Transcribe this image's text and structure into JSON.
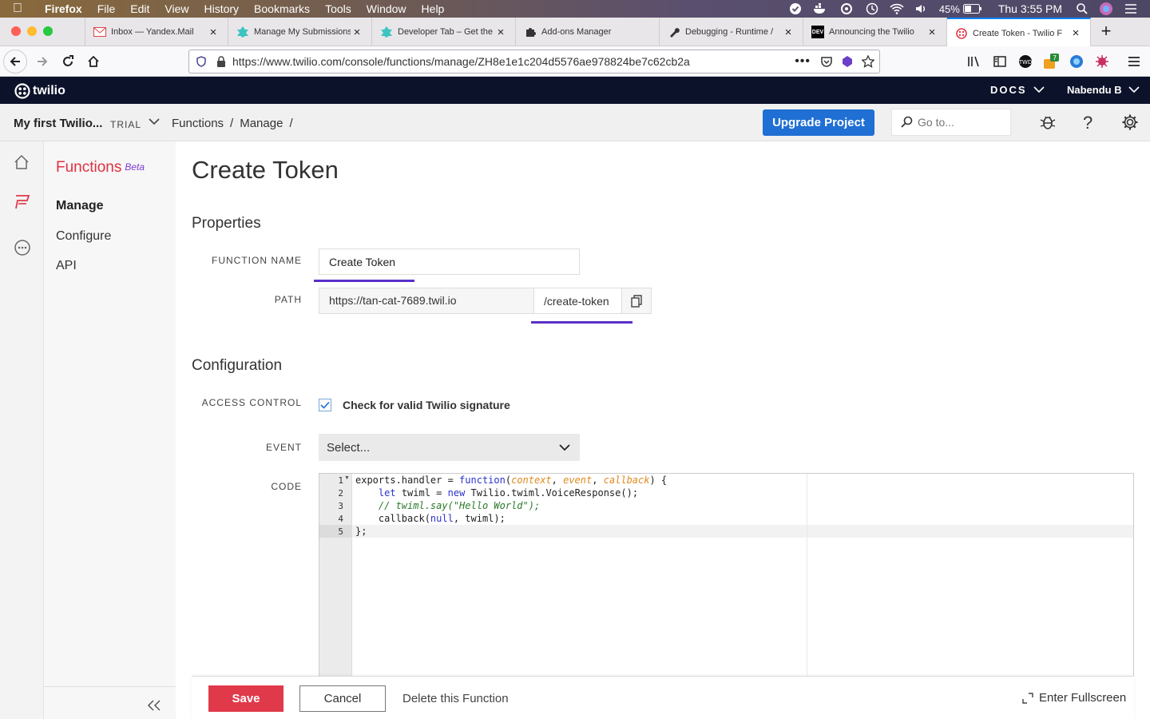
{
  "menubar": {
    "app": "Firefox",
    "items": [
      "File",
      "Edit",
      "View",
      "History",
      "Bookmarks",
      "Tools",
      "Window",
      "Help"
    ],
    "battery": "45%",
    "clock": "Thu 3:55 PM"
  },
  "tabs": [
    {
      "label": "Inbox — Yandex.Mail"
    },
    {
      "label": "Manage My Submissions"
    },
    {
      "label": "Developer Tab – Get the"
    },
    {
      "label": "Add-ons Manager"
    },
    {
      "label": "Debugging - Runtime /"
    },
    {
      "label": "Announcing the Twilio"
    },
    {
      "label": "Create Token - Twilio F"
    }
  ],
  "url": "https://www.twilio.com/console/functions/manage/ZH8e1e1c204d5576ae978824be7c62cb2a",
  "toolbar": {
    "addon_badge": "7"
  },
  "twilio": {
    "logo": "twilio",
    "docs": "DOCS",
    "user": "Nabendu B",
    "project": "My first Twilio...",
    "trial": "TRIAL",
    "breadcrumb": [
      "Functions",
      "/",
      "Manage",
      "/"
    ],
    "upgrade": "Upgrade Project",
    "goto_placeholder": "Go to..."
  },
  "subnav": {
    "title": "Functions",
    "badge": "Beta",
    "items": [
      "Manage",
      "Configure",
      "API"
    ]
  },
  "page": {
    "title": "Create Token",
    "properties_heading": "Properties",
    "function_name_label": "FUNCTION NAME",
    "function_name_value": "Create Token",
    "path_label": "PATH",
    "path_host": "https://tan-cat-7689.twil.io",
    "path_value": "/create-token",
    "configuration_heading": "Configuration",
    "access_control_label": "ACCESS CONTROL",
    "access_control_text": "Check for valid Twilio signature",
    "event_label": "EVENT",
    "event_value": "Select...",
    "code_label": "CODE"
  },
  "code": {
    "lines": [
      {
        "n": "1",
        "t": "exports.handler = function(context, event, callback) {"
      },
      {
        "n": "2",
        "t": "    let twiml = new Twilio.twiml.VoiceResponse();"
      },
      {
        "n": "3",
        "t": "    // twiml.say(\"Hello World\");"
      },
      {
        "n": "4",
        "t": "    callback(null, twiml);"
      },
      {
        "n": "5",
        "t": "};"
      }
    ]
  },
  "footer": {
    "save": "Save",
    "cancel": "Cancel",
    "delete": "Delete this Function",
    "fullscreen": "Enter Fullscreen"
  }
}
